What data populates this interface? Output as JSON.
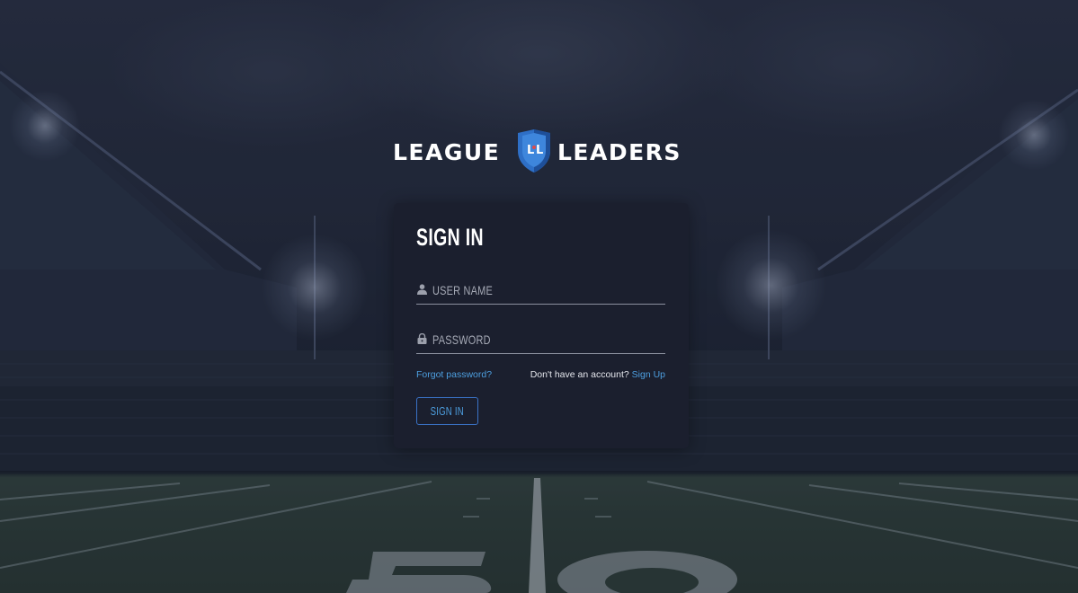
{
  "brand": {
    "word_left": "LEAGUE",
    "word_right": "LEADERS",
    "emblem_letters": "L·L",
    "emblem_icon": "shield-logo-icon"
  },
  "login": {
    "title": "SIGN IN",
    "username": {
      "placeholder": "USER NAME",
      "value": "",
      "icon": "user-icon"
    },
    "password": {
      "placeholder": "PASSWORD",
      "value": "",
      "icon": "lock-icon"
    },
    "forgot_password": "Forgot password?",
    "signup_prompt": "Don't have an account?",
    "signup_link": "Sign Up",
    "submit_label": "SIGN IN"
  },
  "background": {
    "scene": "football stadium at night",
    "field_marking": "50"
  },
  "colors": {
    "card_background": "#1b1f2e",
    "accent_link": "#4d9fe0",
    "button_border": "#3a72c6",
    "shield_blue": "#2e6fc6",
    "shield_dot_red": "#e04a4a"
  }
}
